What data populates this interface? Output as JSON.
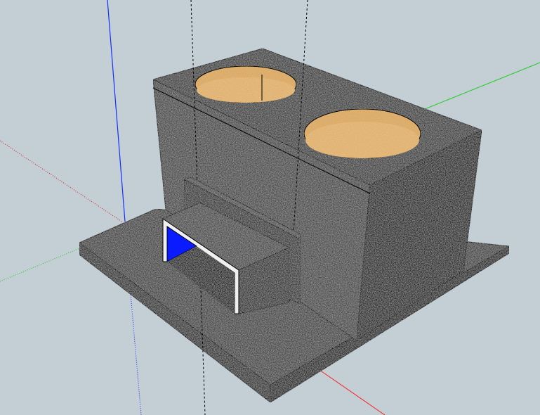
{
  "viewport": {
    "background": "#c3ced5"
  },
  "axes": {
    "red_axis_color": "#ff2020",
    "green_axis_color": "#20cc20",
    "blue_axis_color": "#1030ff"
  },
  "model": {
    "name": "subwoofer-enclosure",
    "speaker_openings": 2,
    "port_count": 1,
    "carpet_color": "#4a4a4a",
    "carpet_dark_color": "#2d2d2d",
    "mdf_color": "#e2b574",
    "port_highlight_color": "#0a1bff",
    "edge_color": "#000000"
  }
}
